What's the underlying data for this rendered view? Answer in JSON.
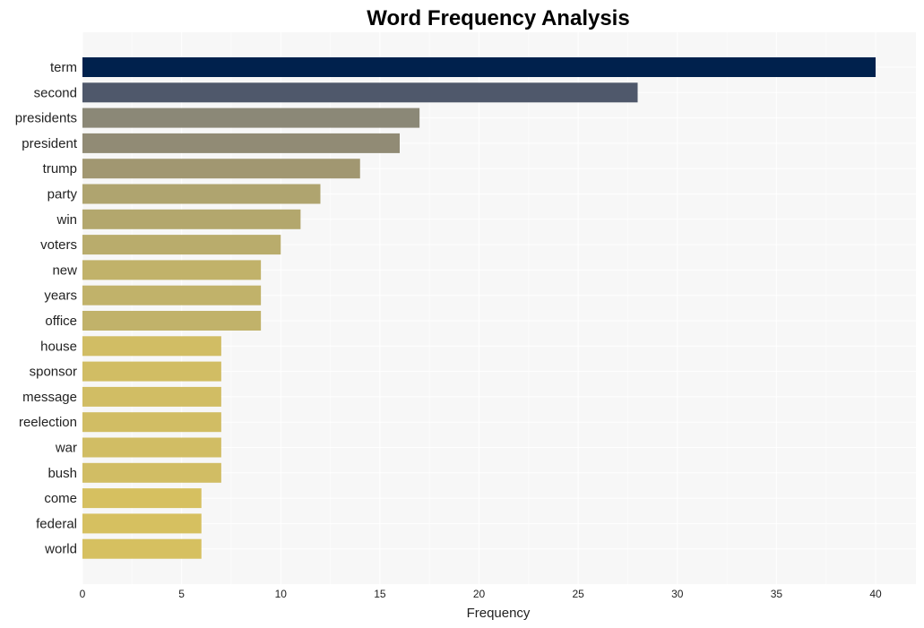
{
  "chart_data": {
    "type": "bar",
    "orientation": "horizontal",
    "title": "Word Frequency Analysis",
    "xlabel": "Frequency",
    "ylabel": "",
    "xlim": [
      0,
      42
    ],
    "xticks": [
      0,
      5,
      10,
      15,
      20,
      25,
      30,
      35,
      40
    ],
    "grid": true,
    "legend": "none",
    "categories": [
      "term",
      "second",
      "presidents",
      "president",
      "trump",
      "party",
      "win",
      "voters",
      "new",
      "years",
      "office",
      "house",
      "sponsor",
      "message",
      "reelection",
      "war",
      "bush",
      "come",
      "federal",
      "world"
    ],
    "values": [
      40,
      28,
      17,
      16,
      14,
      12,
      11,
      10,
      9,
      9,
      9,
      7,
      7,
      7,
      7,
      7,
      7,
      6,
      6,
      6
    ],
    "colors": [
      "#00214d",
      "#4f586b",
      "#8b8877",
      "#918b75",
      "#a19771",
      "#afa46f",
      "#b3a76d",
      "#b9ac6c",
      "#c1b26a",
      "#c1b26a",
      "#c1b26a",
      "#d1bd64",
      "#d1bd64",
      "#d1bd64",
      "#d1bd64",
      "#d1bd64",
      "#d1bd64",
      "#d6c060",
      "#d6c060",
      "#d6c060"
    ]
  }
}
